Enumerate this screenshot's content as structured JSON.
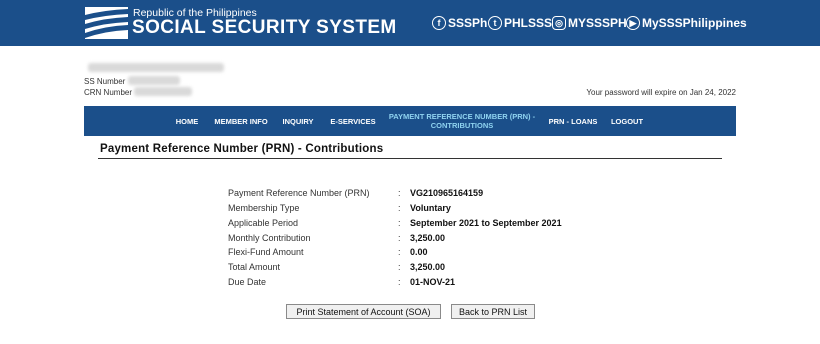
{
  "header": {
    "logo_small": "Republic of the Philippines",
    "logo_big": "SOCIAL SECURITY SYSTEM",
    "social": [
      {
        "icon": "facebook-icon",
        "glyph": "f",
        "label": "SSSPh"
      },
      {
        "icon": "twitter-icon",
        "glyph": "t",
        "label": "PHLSSS"
      },
      {
        "icon": "instagram-icon",
        "glyph": "◎",
        "label": "MYSSSPH"
      },
      {
        "icon": "youtube-icon",
        "glyph": "▶",
        "label": "MySSSPhilippines"
      }
    ]
  },
  "user": {
    "ss_label": "SS Number",
    "crn_label": "CRN Number",
    "password_notice": "Your password will expire on Jan 24, 2022"
  },
  "nav": {
    "items": [
      {
        "label": "HOME"
      },
      {
        "label": "MEMBER INFO"
      },
      {
        "label": "INQUIRY"
      },
      {
        "label": "E-SERVICES"
      },
      {
        "label": "PAYMENT REFERENCE NUMBER (PRN) - CONTRIBUTIONS"
      },
      {
        "label": "PRN - LOANS"
      },
      {
        "label": "LOGOUT"
      }
    ]
  },
  "page": {
    "title": "Payment Reference Number (PRN) - Contributions"
  },
  "details": [
    {
      "label": "Payment Reference Number (PRN)",
      "value": "VG210965164159"
    },
    {
      "label": "Membership Type",
      "value": "Voluntary"
    },
    {
      "label": "Applicable Period",
      "value": "September 2021 to September 2021"
    },
    {
      "label": "Monthly Contribution",
      "value": "3,250.00"
    },
    {
      "label": "Flexi-Fund Amount",
      "value": "0.00"
    },
    {
      "label": "Total Amount",
      "value": "3,250.00"
    },
    {
      "label": "Due Date",
      "value": "01-NOV-21"
    }
  ],
  "buttons": {
    "print_soa": "Print Statement of Account (SOA)",
    "back": "Back to PRN List"
  },
  "colors": {
    "banner": "#1b4f8a",
    "nav_active": "#8fd3f0"
  }
}
